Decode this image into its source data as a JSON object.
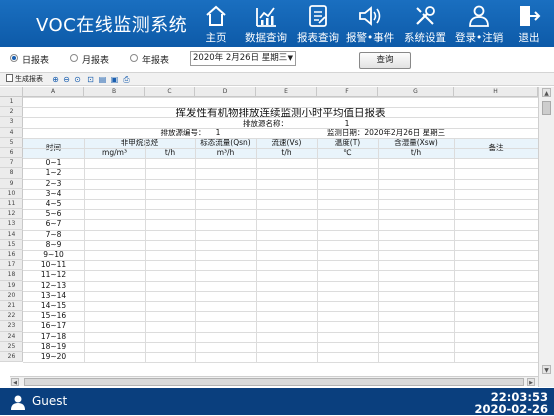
{
  "app": {
    "title": "VOC在线监测系统"
  },
  "nav": [
    {
      "label": "主页",
      "icon": "home-icon"
    },
    {
      "label": "数据查询",
      "icon": "chart-icon"
    },
    {
      "label": "报表查询",
      "icon": "report-icon"
    },
    {
      "label": "报警•事件",
      "icon": "speaker-icon"
    },
    {
      "label": "系统设置",
      "icon": "tools-icon"
    },
    {
      "label": "登录•注销",
      "icon": "user-icon"
    },
    {
      "label": "退出",
      "icon": "exit-icon"
    }
  ],
  "filters": {
    "report_types": [
      {
        "label": "日报表",
        "selected": true
      },
      {
        "label": "月报表",
        "selected": false
      },
      {
        "label": "年报表",
        "selected": false
      }
    ],
    "date_value": "2020年  2月26日 星期三",
    "query_label": "查询"
  },
  "toolbar": {
    "generate_label": "生成报表"
  },
  "sheet": {
    "columns": [
      "A",
      "B",
      "C",
      "D",
      "E",
      "F",
      "G",
      "H"
    ],
    "title": "挥发性有机物排放连续监测小时平均值日报表",
    "source_name_label": "排放源名称：",
    "source_name_value": "1",
    "source_no_label": "排放源编号：",
    "source_no_value": "1",
    "monitor_date_label": "监测日期：2020年2月26日 星期三",
    "headers": {
      "time": "时间",
      "nmhc": "非甲烷总烃",
      "flow": "标态流量(Qsn)",
      "velocity": "流速(Vs)",
      "temp": "温度(T)",
      "moisture": "含湿量(Xsw)",
      "remark": "备注"
    },
    "units": {
      "nmhc_conc": "mg/m³",
      "nmhc_rate": "t/h",
      "flow": "m³/h",
      "velocity": "t/h",
      "temp": "℃",
      "moisture": "t/h"
    },
    "time_rows": [
      "0~1",
      "1~2",
      "2~3",
      "3~4",
      "4~5",
      "5~6",
      "6~7",
      "7~8",
      "8~9",
      "9~10",
      "10~11",
      "11~12",
      "12~13",
      "13~14",
      "14~15",
      "15~16",
      "16~17",
      "17~18",
      "18~19",
      "19~20"
    ],
    "row_numbers": [
      "1",
      "2",
      "3",
      "4",
      "5",
      "6",
      "7",
      "8",
      "9",
      "10",
      "11",
      "12",
      "13",
      "14",
      "15",
      "16",
      "17",
      "18",
      "19",
      "20",
      "21",
      "22",
      "23",
      "24",
      "25",
      "26"
    ]
  },
  "status": {
    "user": "Guest",
    "time": "22:03:53",
    "date": "2020-02-26"
  }
}
